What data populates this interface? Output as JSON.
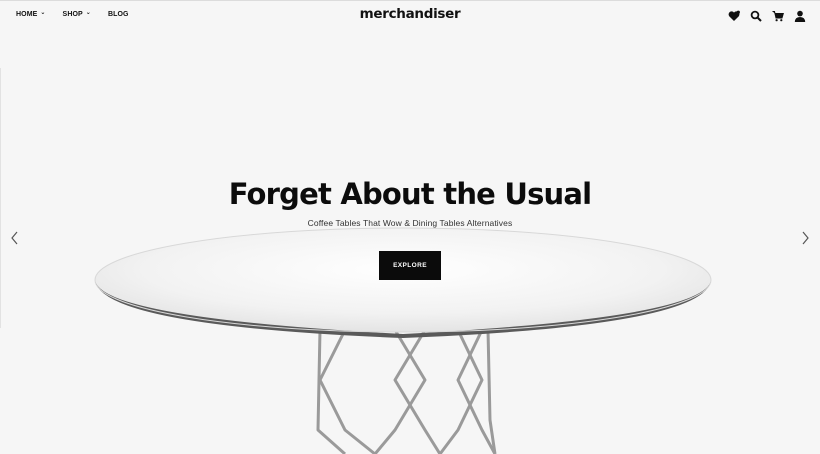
{
  "nav": {
    "menu": [
      {
        "label": "HOME",
        "has_dropdown": true
      },
      {
        "label": "SHOP",
        "has_dropdown": true
      },
      {
        "label": "BLOG",
        "has_dropdown": false
      }
    ],
    "logo": "merchandiser",
    "icons": [
      "wishlist-heart-icon",
      "search-icon",
      "cart-icon",
      "account-icon"
    ]
  },
  "hero": {
    "title": "Forget About the Usual",
    "subtitle": "Coffee Tables That Wow & Dining Tables Alternatives",
    "button_label": "EXPLORE"
  },
  "slider": {
    "prev_icon": "chevron-left-icon",
    "next_icon": "chevron-right-icon"
  },
  "colors": {
    "background": "#f6f6f6",
    "text": "#111111",
    "button_bg": "#0b0b0b",
    "button_text": "#ffffff"
  }
}
